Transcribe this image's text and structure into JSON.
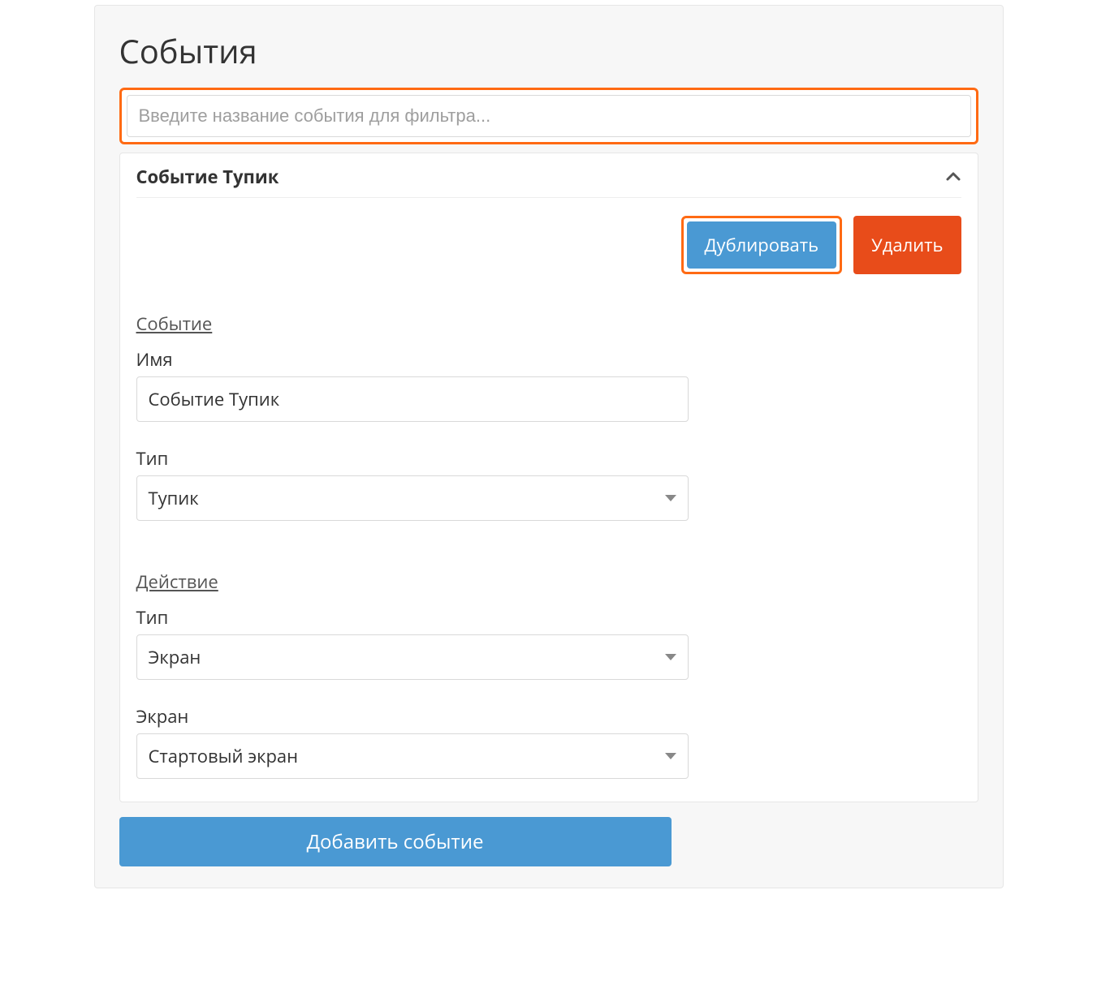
{
  "page_title": "События",
  "filter": {
    "placeholder": "Введите название события для фильтра..."
  },
  "event": {
    "title": "Событие Тупик",
    "buttons": {
      "duplicate": "Дублировать",
      "delete": "Удалить"
    },
    "sections": {
      "event": {
        "heading": "Событие",
        "name_label": "Имя",
        "name_value": "Событие Тупик",
        "type_label": "Тип",
        "type_value": "Тупик"
      },
      "action": {
        "heading": "Действие",
        "type_label": "Тип",
        "type_value": "Экран",
        "screen_label": "Экран",
        "screen_value": "Стартовый экран"
      }
    }
  },
  "add_button_label": "Добавить событие"
}
